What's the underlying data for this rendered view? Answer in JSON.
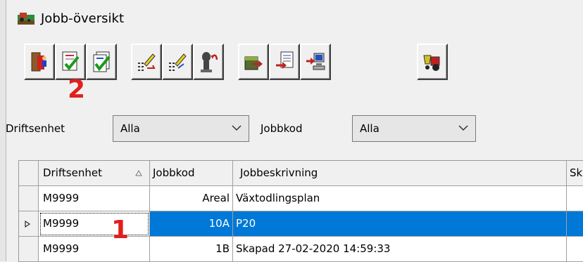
{
  "window": {
    "title": "Jobb-översikt",
    "icon": "field-tractor-icon"
  },
  "toolbar": {
    "buttons": [
      {
        "name": "exit-button",
        "icon": "exit-door-icon"
      },
      {
        "name": "check-document-button",
        "icon": "check-document-icon"
      },
      {
        "name": "check-all-button",
        "icon": "check-all-icon"
      },
      {
        "name": "edit-list-button",
        "icon": "edit-list-icon"
      },
      {
        "name": "edit-list-alt-button",
        "icon": "edit-list-alt-icon"
      },
      {
        "name": "undo-job-button",
        "icon": "undo-job-icon"
      },
      {
        "name": "export-box-button",
        "icon": "export-box-icon"
      },
      {
        "name": "transfer-document-button",
        "icon": "transfer-document-icon"
      },
      {
        "name": "send-to-computer-button",
        "icon": "send-computer-icon"
      },
      {
        "name": "machine-button",
        "icon": "tractor-spreader-icon"
      }
    ]
  },
  "markers": {
    "one": "1",
    "two": "2"
  },
  "filters": {
    "driftsenhet_label": "Driftsenhet",
    "driftsenhet_value": "Alla",
    "jobbkod_label": "Jobbkod",
    "jobbkod_value": "Alla"
  },
  "grid": {
    "columns": [
      "Driftsenhet",
      "Jobbkod",
      "Jobbeskrivning",
      "Sk"
    ],
    "rows": [
      {
        "driftsenhet": "M9999",
        "jobbkod": "Areal",
        "jobbeskrivning": "Växtodlingsplan",
        "sk": ""
      },
      {
        "driftsenhet": "M9999",
        "jobbkod": "10A",
        "jobbeskrivning": "P20",
        "sk": ""
      },
      {
        "driftsenhet": "M9999",
        "jobbkod": "1B",
        "jobbeskrivning": "Skapad 27-02-2020 14:59:33",
        "sk": ""
      }
    ],
    "selected_row": 1
  },
  "colors": {
    "selection": "#0078d7",
    "marker": "#e0201e"
  }
}
